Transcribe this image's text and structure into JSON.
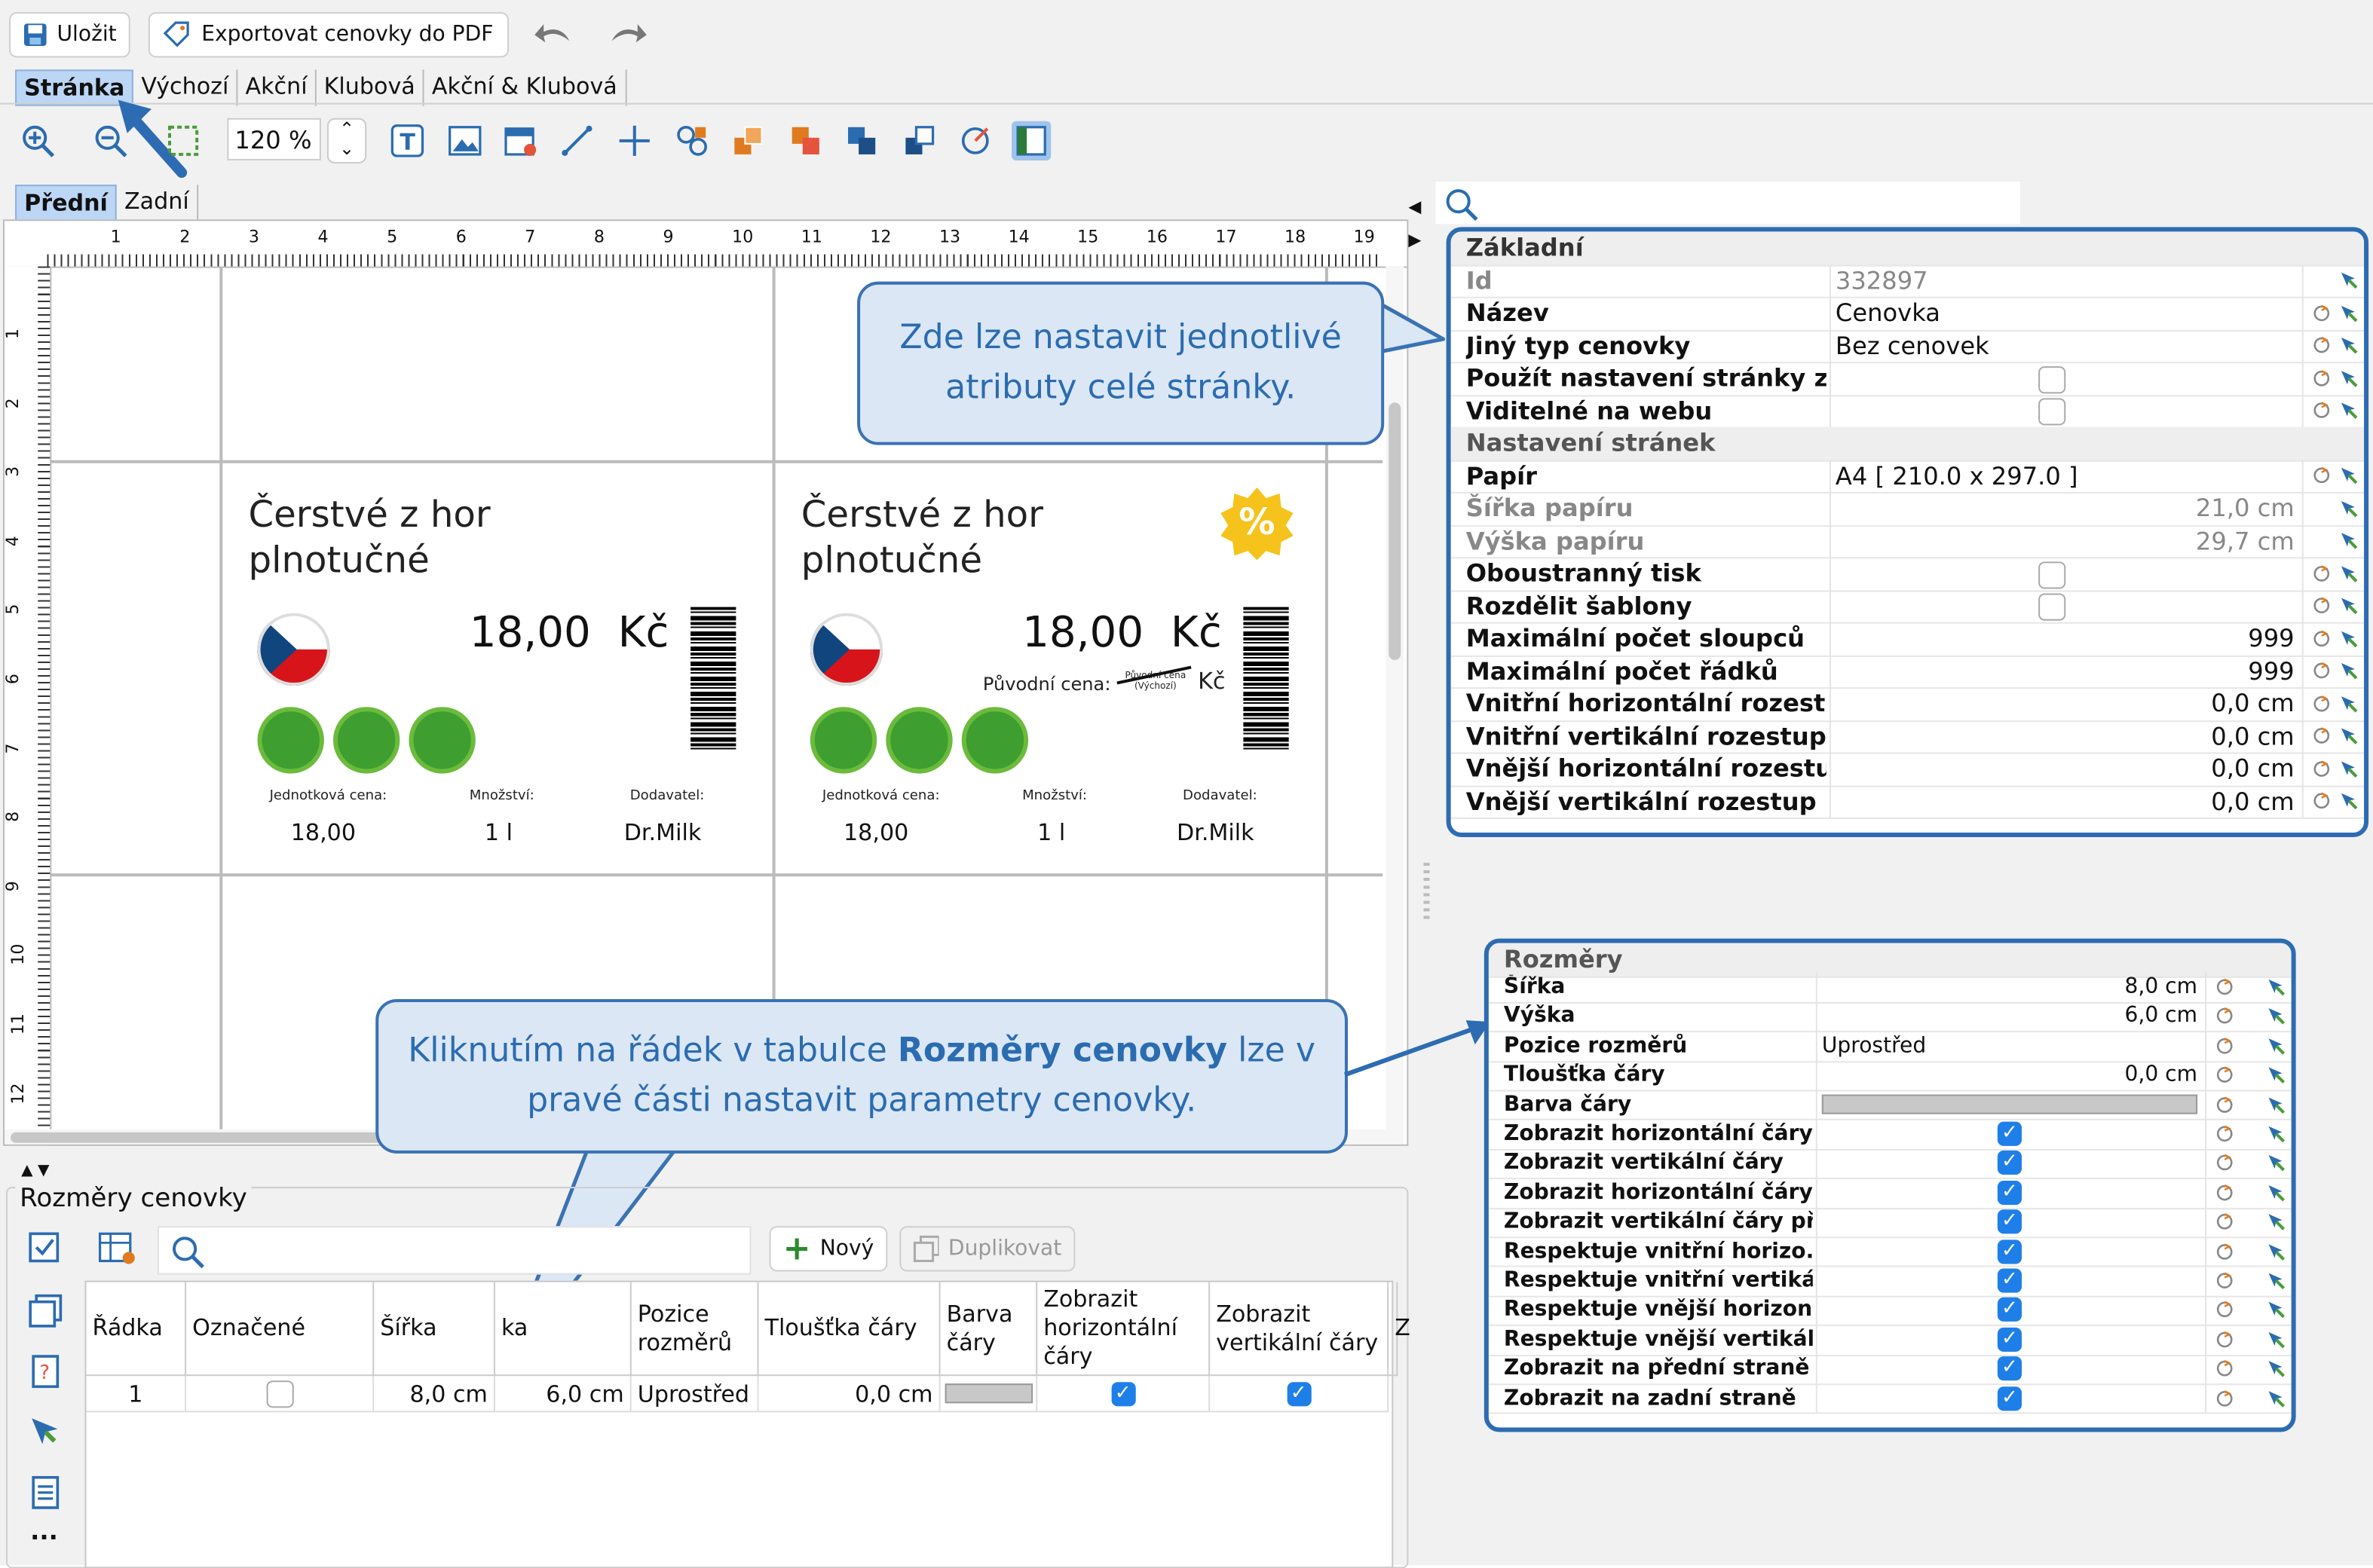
{
  "toolbar": {
    "save": "Uložit",
    "export": "Exportovat cenovky do PDF",
    "zoom": "120 %"
  },
  "tabs": [
    "Stránka",
    "Výchozí",
    "Akční",
    "Klubová",
    "Akční & Klubová"
  ],
  "sides": [
    "Přední",
    "Zadní"
  ],
  "ruler_h": [
    "1",
    "2",
    "3",
    "4",
    "5",
    "6",
    "7",
    "8",
    "9",
    "10",
    "11",
    "12",
    "13",
    "14",
    "15",
    "16",
    "17",
    "18",
    "19"
  ],
  "ruler_v": [
    "1",
    "2",
    "3",
    "4",
    "5",
    "6",
    "7",
    "8",
    "9",
    "10",
    "11",
    "12"
  ],
  "labels": [
    {
      "title_line1": "Čerstvé z hor",
      "title_line2": "plnotučné",
      "price": "18,00",
      "currency": "Kč",
      "unit_price_label": "Jednotková cena:",
      "qty_label": "Množství:",
      "supplier_label": "Dodavatel:",
      "unit_price": "18,00",
      "qty": "1 l",
      "supplier": "Dr.Milk"
    },
    {
      "title_line1": "Čerstvé z hor",
      "title_line2": "plnotučné",
      "price": "18,00",
      "currency": "Kč",
      "orig_label": "Původní cena:",
      "orig_small": "Původní cena (Výchozí)",
      "orig_currency": "Kč",
      "badge": "%",
      "unit_price_label": "Jednotková cena:",
      "qty_label": "Množství:",
      "supplier_label": "Dodavatel:",
      "unit_price": "18,00",
      "qty": "1 l",
      "supplier": "Dr.Milk"
    }
  ],
  "callout1": "Zde lze nastavit jednotlivé atributy celé stránky.",
  "callout2": {
    "pre": "Kliknutím na řádek v tabulce ",
    "bold": "Rozměry cenovky",
    "post": " lze v pravé části nastavit parametry cenovky."
  },
  "page_props": {
    "section1": "Základní",
    "rows1": [
      {
        "name": "Id",
        "value": "332897",
        "gray": true
      },
      {
        "name": "Název",
        "value": "Cenovka"
      },
      {
        "name": "Jiný typ cenovky",
        "value": "Bez cenovek"
      },
      {
        "name": "Použít nastavení stránky z ...",
        "check": false
      },
      {
        "name": "Viditelné na webu",
        "check": false
      }
    ],
    "section2": "Nastavení stránek",
    "rows2": [
      {
        "name": "Papír",
        "value": "A4 [ 210.0 x 297.0 ]"
      },
      {
        "name": "Šířka papíru",
        "value": "21,0 cm",
        "gray": true,
        "right": true
      },
      {
        "name": "Výška papíru",
        "value": "29,7 cm",
        "gray": true,
        "right": true
      },
      {
        "name": "Oboustranný tisk",
        "check": false
      },
      {
        "name": "Rozdělit šablony",
        "check": false
      },
      {
        "name": "Maximální počet sloupců",
        "value": "999",
        "right": true
      },
      {
        "name": "Maximální počet řádků",
        "value": "999",
        "right": true
      },
      {
        "name": "Vnitřní horizontální rozest...",
        "value": "0,0 cm",
        "right": true
      },
      {
        "name": "Vnitřní vertikální rozestup",
        "value": "0,0 cm",
        "right": true
      },
      {
        "name": "Vnější horizontální rozestup",
        "value": "0,0 cm",
        "right": true
      },
      {
        "name": "Vnější vertikální rozestup",
        "value": "0,0 cm",
        "right": true
      }
    ]
  },
  "dim_props": {
    "section": "Rozměry",
    "rows": [
      {
        "name": "Šířka",
        "value": "8,0 cm",
        "right": true
      },
      {
        "name": "Výška",
        "value": "6,0 cm",
        "right": true
      },
      {
        "name": "Pozice rozměrů",
        "value": "Uprostřed"
      },
      {
        "name": "Tloušťka čáry",
        "value": "0,0 cm",
        "right": true
      },
      {
        "name": "Barva čáry",
        "color": "#c8c8c8"
      },
      {
        "name": "Zobrazit horizontální čáry",
        "check": true
      },
      {
        "name": "Zobrazit vertikální čáry",
        "check": true
      },
      {
        "name": "Zobrazit horizontální čáry...",
        "check": true
      },
      {
        "name": "Zobrazit vertikální čáry př...",
        "check": true
      },
      {
        "name": "Respektuje vnitřní horizo...",
        "check": true
      },
      {
        "name": "Respektuje vnitřní vertiká...",
        "check": true
      },
      {
        "name": "Respektuje vnější horizon...",
        "check": true
      },
      {
        "name": "Respektuje vnější vertikál...",
        "check": true
      },
      {
        "name": "Zobrazit na přední straně",
        "check": true
      },
      {
        "name": "Zobrazit na zadní straně",
        "check": true
      }
    ]
  },
  "dim_section_title": "Rozměry cenovky",
  "dim_toolbar": {
    "new": "Nový",
    "duplicate": "Duplikovat"
  },
  "dim_table": {
    "headers": [
      "Řádka",
      "Označené",
      "Šířka",
      "ka",
      "Pozice rozměrů",
      "Tloušťka čáry",
      "Barva čáry",
      "Zobrazit horizontální čáry",
      "Zobrazit vertikální čáry",
      "Z"
    ],
    "row": {
      "radka": "1",
      "sirka": "8,0 cm",
      "vyska": "6,0 cm",
      "pozice": "Uprostřed",
      "tloustka": "0,0 cm"
    }
  },
  "colors": {
    "accent": "#2d6cb3",
    "callout_bg": "#dbe7f5",
    "tab_active": "#bcd6f5",
    "check_blue": "#1f7fe8",
    "badge_green": "#3e9e2f",
    "percent_yellow": "#f6c31c"
  }
}
